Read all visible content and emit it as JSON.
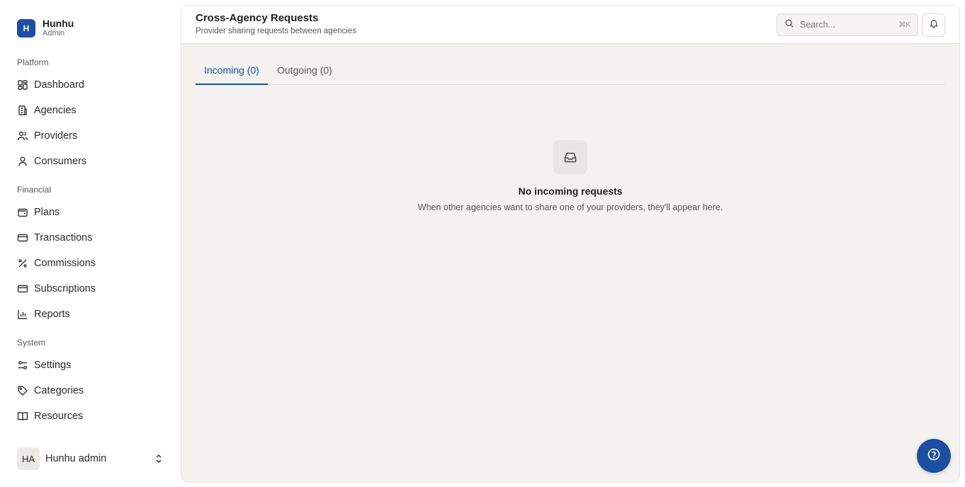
{
  "brand": {
    "logo_letter": "H",
    "name": "Hunhu",
    "role": "Admin"
  },
  "sidebar": {
    "sections": [
      {
        "title": "Platform",
        "items": [
          {
            "label": "Dashboard",
            "icon": "dashboard-icon"
          },
          {
            "label": "Agencies",
            "icon": "building-icon"
          },
          {
            "label": "Providers",
            "icon": "users-icon"
          },
          {
            "label": "Consumers",
            "icon": "user-icon"
          }
        ]
      },
      {
        "title": "Financial",
        "items": [
          {
            "label": "Plans",
            "icon": "wallet-icon"
          },
          {
            "label": "Transactions",
            "icon": "credit-card-icon"
          },
          {
            "label": "Commissions",
            "icon": "percent-icon"
          },
          {
            "label": "Subscriptions",
            "icon": "credit-card-icon"
          },
          {
            "label": "Reports",
            "icon": "bar-chart-icon"
          }
        ]
      },
      {
        "title": "System",
        "items": [
          {
            "label": "Settings",
            "icon": "sliders-icon"
          },
          {
            "label": "Categories",
            "icon": "tag-icon"
          },
          {
            "label": "Resources",
            "icon": "book-icon"
          }
        ]
      }
    ]
  },
  "user": {
    "initials": "HA",
    "name": "Hunhu admin"
  },
  "header": {
    "title": "Cross-Agency Requests",
    "subtitle": "Provider sharing requests between agencies",
    "search_placeholder": "Search...",
    "search_shortcut": "⌘K"
  },
  "tabs": [
    {
      "label": "Incoming (0)",
      "active": true
    },
    {
      "label": "Outgoing (0)",
      "active": false
    }
  ],
  "empty_state": {
    "icon": "inbox-icon",
    "title": "No incoming requests",
    "description": "When other agencies want to share one of your providers, they'll appear here."
  },
  "colors": {
    "accent": "#1d4ea1",
    "main_bg": "#f3f2ef"
  }
}
